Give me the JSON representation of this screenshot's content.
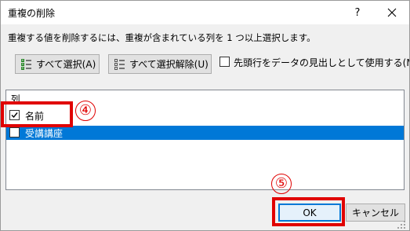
{
  "dialog": {
    "title": "重複の削除",
    "help_label": "?",
    "instruction": "重複する値を削除するには、重複が含まれている列を 1 つ以上選択します。",
    "select_all_label": "すべて選択(A)",
    "unselect_all_label": "すべて選択解除(U)",
    "header_option_label": "先頭行をデータの見出しとして使用する(M)",
    "header_option_checked": false,
    "list_header": "列",
    "columns": [
      {
        "label": "名前",
        "checked": true,
        "selected": false
      },
      {
        "label": "受講講座",
        "checked": false,
        "selected": true
      }
    ],
    "ok_label": "OK",
    "cancel_label": "キャンセル"
  },
  "annotations": {
    "step_4": "④",
    "step_5": "⑤"
  },
  "colors": {
    "accent": "#0078d7",
    "highlight": "#e00000",
    "dialog_bg": "#f0f0f0"
  },
  "icons": [
    "help-icon",
    "close-icon",
    "select-all-icon",
    "unselect-all-icon",
    "checkbox-checked-icon",
    "size-grip-icon"
  ]
}
